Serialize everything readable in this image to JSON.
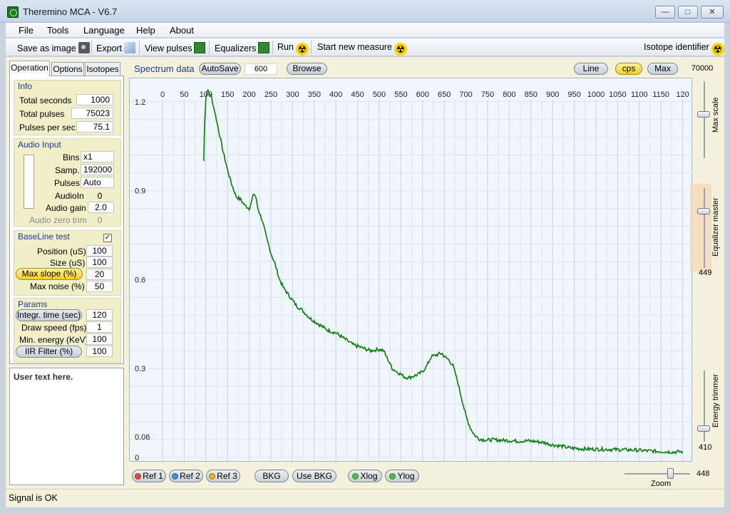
{
  "window": {
    "title": "Theremino MCA - V6.7"
  },
  "menu": [
    "File",
    "Tools",
    "Language",
    "Help",
    "About"
  ],
  "toolbar": {
    "save_image": "Save as image",
    "export": "Export",
    "view_pulses": "View pulses",
    "equalizers": "Equalizers",
    "run": "Run",
    "start_new": "Start new measure",
    "isotope_identifier": "Isotope identifier"
  },
  "tabs": {
    "operation": "Operation",
    "options": "Options",
    "isotopes": "Isotopes"
  },
  "info": {
    "title": "Info",
    "total_seconds_label": "Total seconds",
    "total_seconds": "1000",
    "total_pulses_label": "Total pulses",
    "total_pulses": "75023",
    "pps_label": "Pulses per sec.",
    "pps": "75.1"
  },
  "audio": {
    "title": "Audio Input",
    "bins_label": "Bins",
    "bins": "x1",
    "samp_label": "Samp.",
    "samp": "192000",
    "pulses_label": "Pulses",
    "pulses": "Auto",
    "audioin_label": "AudioIn",
    "audioin": "0",
    "gain_label": "Audio gain",
    "gain": "2.0",
    "zero_trim_label": "Audio zero trim",
    "zero_trim": "0"
  },
  "baseline": {
    "title": "BaseLine test",
    "position_label": "Position (uS)",
    "position": "100",
    "size_label": "Size (uS)",
    "size": "100",
    "max_slope_label": "Max slope (%)",
    "max_slope": "20",
    "max_noise_label": "Max noise (%)",
    "max_noise": "50"
  },
  "params": {
    "title": "Params",
    "integr_label": "Integr. time (sec)",
    "integr": "120",
    "draw_speed_label": "Draw speed (fps)",
    "draw_speed": "1",
    "min_energy_label": "Min. energy (KeV)",
    "min_energy": "100",
    "iir_label": "IIR Filter (%)",
    "iir": "100"
  },
  "user_text": "User text here.",
  "spectrum_bar": {
    "label": "Spectrum data",
    "autosave": "AutoSave",
    "autosave_value": "600",
    "browse": "Browse",
    "line": "Line",
    "cps": "cps",
    "max": "Max",
    "max_value": "70000"
  },
  "right_controls": {
    "max_scale": "Max scale",
    "equalizer_master": "Equalizer master",
    "equalizer_value": "449",
    "energy_trimmer": "Energy trimmer",
    "energy_value": "410"
  },
  "bottom_bar": {
    "ref1": "Ref 1",
    "ref2": "Ref 2",
    "ref3": "Ref 3",
    "bkg": "BKG",
    "use_bkg": "Use BKG",
    "xlog": "Xlog",
    "ylog": "Ylog",
    "zoom_label": "Zoom",
    "zoom_value": "448"
  },
  "status": "Signal is OK",
  "colors": {
    "accent_blue": "#1c3a9a",
    "panel_bg": "#f4f1dc",
    "group_bg": "#f0efc8",
    "chart_bg": "#f0f6fc",
    "trace": "#0a7a0a",
    "highlight": "#f5cf1a"
  },
  "chart_data": {
    "type": "line",
    "x_ticks": [
      "0",
      "50",
      "100",
      "150",
      "200",
      "250",
      "300",
      "350",
      "400",
      "450",
      "500",
      "550",
      "600",
      "650",
      "700",
      "750",
      "800",
      "850",
      "900",
      "950",
      "1000",
      "1050",
      "1100",
      "1150",
      "120"
    ],
    "y_ticks": [
      "1.2",
      "0.9",
      "0.6",
      "0.3",
      "0.06",
      "0"
    ],
    "xlim": [
      0,
      1200
    ],
    "ylim": [
      0,
      1.25
    ],
    "grid": true,
    "series": [
      {
        "x": [
          95,
          97,
          100,
          103,
          107,
          112,
          120,
          130,
          140,
          150,
          160,
          170,
          180,
          190,
          200,
          205,
          210,
          215,
          220,
          230,
          240,
          250,
          260,
          270,
          280,
          290,
          300,
          310,
          320,
          340,
          360,
          380,
          400,
          420,
          440,
          460,
          480,
          500,
          510,
          520,
          530,
          540,
          550,
          560,
          570,
          580,
          590,
          600,
          610,
          620,
          630,
          640,
          645,
          650,
          660,
          670,
          680,
          690,
          700,
          710,
          720,
          730,
          740,
          750,
          760,
          780,
          800,
          820,
          840,
          860,
          880,
          900,
          920,
          940,
          960,
          980,
          1000,
          1030,
          1060,
          1090,
          1120,
          1150,
          1180,
          1200
        ],
        "y": [
          1.0,
          1.13,
          1.21,
          1.24,
          1.23,
          1.22,
          1.17,
          1.1,
          1.03,
          0.97,
          0.92,
          0.88,
          0.87,
          0.85,
          0.84,
          0.86,
          0.89,
          0.88,
          0.84,
          0.8,
          0.74,
          0.69,
          0.65,
          0.6,
          0.57,
          0.55,
          0.53,
          0.51,
          0.5,
          0.47,
          0.45,
          0.43,
          0.42,
          0.4,
          0.38,
          0.37,
          0.36,
          0.365,
          0.36,
          0.33,
          0.3,
          0.29,
          0.28,
          0.27,
          0.27,
          0.275,
          0.28,
          0.29,
          0.31,
          0.34,
          0.345,
          0.35,
          0.35,
          0.34,
          0.33,
          0.31,
          0.26,
          0.2,
          0.14,
          0.1,
          0.075,
          0.063,
          0.06,
          0.058,
          0.06,
          0.058,
          0.057,
          0.055,
          0.056,
          0.054,
          0.05,
          0.042,
          0.038,
          0.032,
          0.03,
          0.028,
          0.028,
          0.027,
          0.026,
          0.025,
          0.022,
          0.02,
          0.018,
          0.02
        ]
      }
    ]
  }
}
